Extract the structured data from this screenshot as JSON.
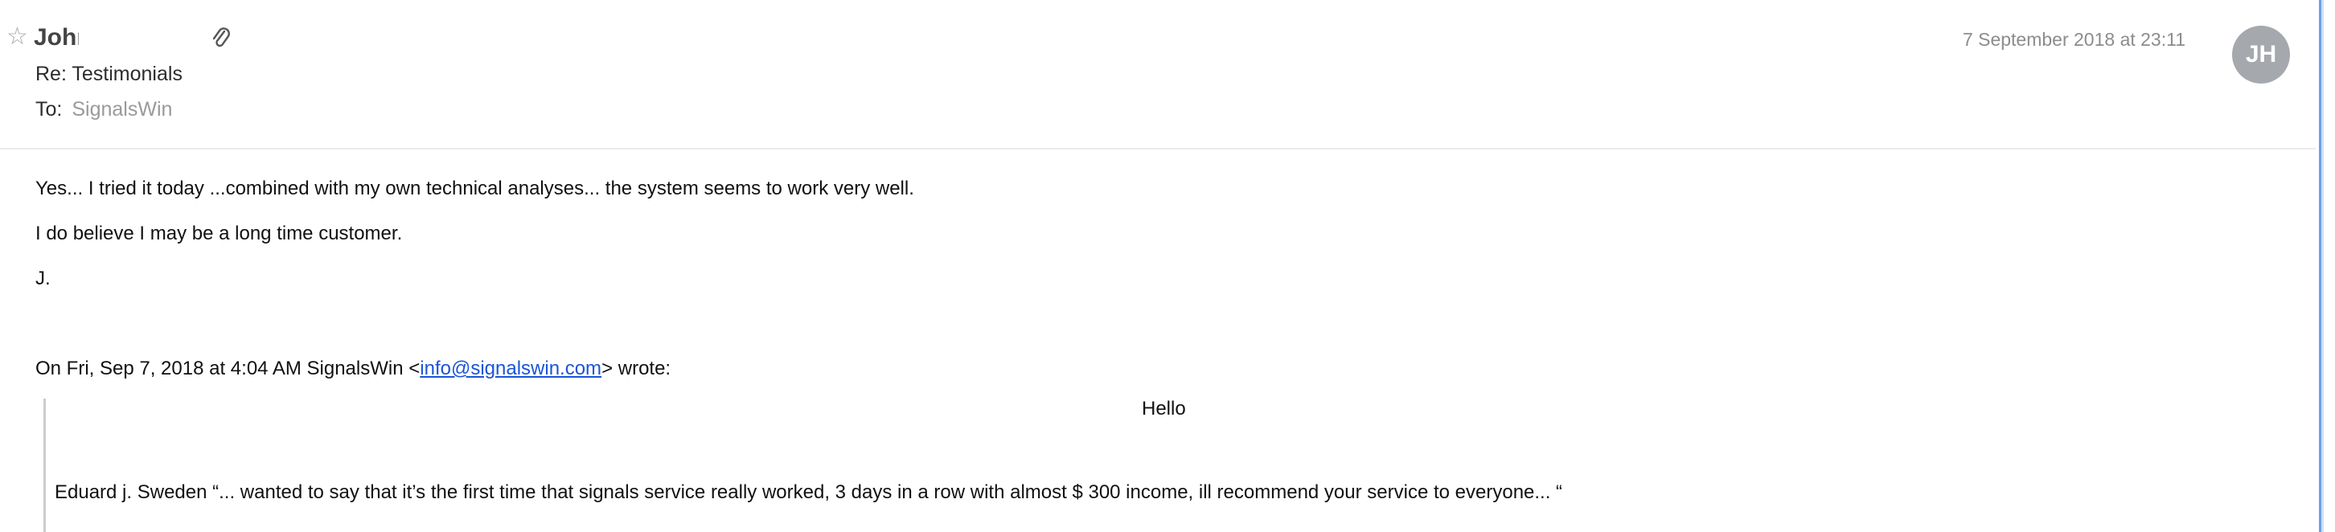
{
  "header": {
    "star_glyph": "☆",
    "sender_name": "John",
    "subject": "Re: Testimonials",
    "to_label": "To:",
    "to_name": "SignalsWin",
    "date": "7 September 2018 at 23:11",
    "avatar_initials": "JH"
  },
  "body": {
    "lines": [
      "Yes... I tried it today ...combined with my own technical analyses... the system seems to work very well.",
      "I do believe I may be a long time customer.",
      "J."
    ],
    "quote_intro_before": "On Fri, Sep 7, 2018 at 4:04 AM SignalsWin <",
    "quote_email": "info@signalswin.com",
    "quote_intro_after": "> wrote:"
  },
  "quote": {
    "hello": "Hello",
    "testimonial": "Eduard j. Sweden “... wanted to say that it’s the first time that signals service really worked, 3 days in a row with almost $ 300 income, ill recommend your service to everyone... “"
  },
  "colors": {
    "link": "#1a55d6",
    "avatar_bg": "#a5a8ac",
    "accent_bar": "#6aa0e6"
  },
  "icons": {
    "star": "star-icon",
    "attachment": "paperclip-icon"
  }
}
